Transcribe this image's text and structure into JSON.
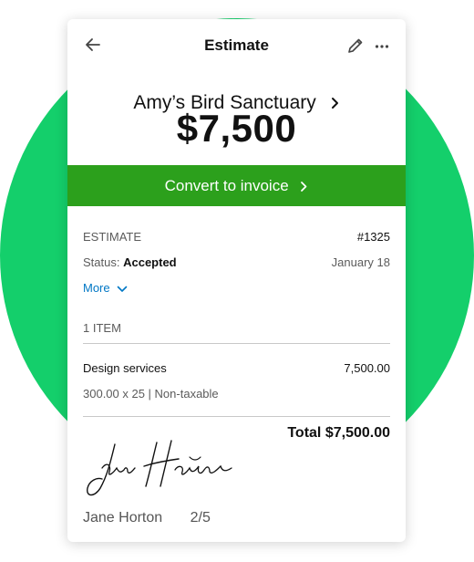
{
  "topbar": {
    "title": "Estimate"
  },
  "customer": {
    "name": "Amy’s Bird Sanctuary"
  },
  "amount": "$7,500",
  "convert": {
    "label": "Convert to invoice"
  },
  "estimate": {
    "label": "ESTIMATE",
    "number": "#1325",
    "status_label": "Status:",
    "status_value": "Accepted",
    "date": "January 18",
    "more_label": "More"
  },
  "items": {
    "count_label": "1 ITEM",
    "lines": [
      {
        "name": "Design services",
        "amount": "7,500.00",
        "detail": "300.00 x 25 | Non-taxable"
      }
    ],
    "total": "Total $7,500.00"
  },
  "signature": {
    "name": "Jane Horton"
  },
  "footer": {
    "signer": "Jane Horton",
    "page": "2/5"
  },
  "colors": {
    "accent_green": "#2ca01c",
    "brand_circle": "#14cf6b",
    "link_blue": "#0077c5"
  },
  "icons": [
    "back-arrow-icon",
    "pencil-icon",
    "more-dots-icon",
    "chevron-right-icon",
    "chevron-down-icon"
  ]
}
